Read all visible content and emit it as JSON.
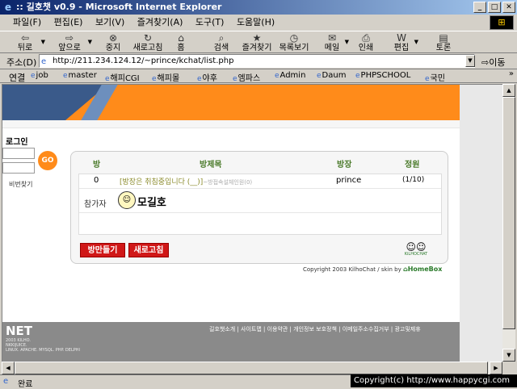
{
  "window": {
    "title": ":: 길호챗 v0.9 - Microsoft Internet Explorer",
    "min": "_",
    "max": "□",
    "close": "✕"
  },
  "menu": [
    "파일(F)",
    "편집(E)",
    "보기(V)",
    "즐겨찾기(A)",
    "도구(T)",
    "도움말(H)"
  ],
  "toolbar": {
    "back": "뒤로",
    "forward": "앞으로",
    "stop": "중지",
    "refresh": "새로고침",
    "home": "홈",
    "search": "검색",
    "favorites": "즐겨찾기",
    "history": "목록보기",
    "mail": "메일",
    "print": "인쇄",
    "edit": "편집",
    "discuss": "토론"
  },
  "address": {
    "label": "주소(D)",
    "url": "http://211.234.124.12/~prince/kchat/list.php",
    "go": "이동"
  },
  "links": {
    "label": "연결",
    "items": [
      "job",
      "master",
      "해피CGI",
      "해피몰",
      "야후",
      "엠파스",
      "Admin",
      "Daum",
      "PHPSCHOOL",
      "국민"
    ],
    "more": "»"
  },
  "page": {
    "login_title": "로그인",
    "go_button": "GO",
    "find_pw": "비번찾기",
    "headers": {
      "no": "방",
      "title": "방제목",
      "owner": "방장",
      "capacity": "정원"
    },
    "rooms": [
      {
        "no": "0",
        "title": "[방장은 취침중입니다 (__)]",
        "subtitle": "~방접속설체인원(0)",
        "owner": "prince",
        "capacity": "(1/10)"
      }
    ],
    "participants_label": "참가자",
    "participant_name": "모길호",
    "buttons": {
      "make_room": "방만들기",
      "refresh": "새로고침"
    },
    "kilho_logo": "KiLHOCHAT",
    "copyright": "Copyright 2003 KilhoChat / skin by",
    "homebox": "HomeBox",
    "footer": {
      "brand": "NET",
      "info": [
        "2003 KILHO.",
        "NKKIJUICE.",
        "LINUX. APACHE. MYSQL. PHP. DELPHI"
      ],
      "links": "길호챗소개 | 사이트맵 | 이용약관 | 개인정보 보호정책 | 이메일주소수집거부 | 광고및제휴"
    }
  },
  "status": {
    "text": "완료",
    "overlay": "Copyright(c) http://www.happycgi.com"
  }
}
